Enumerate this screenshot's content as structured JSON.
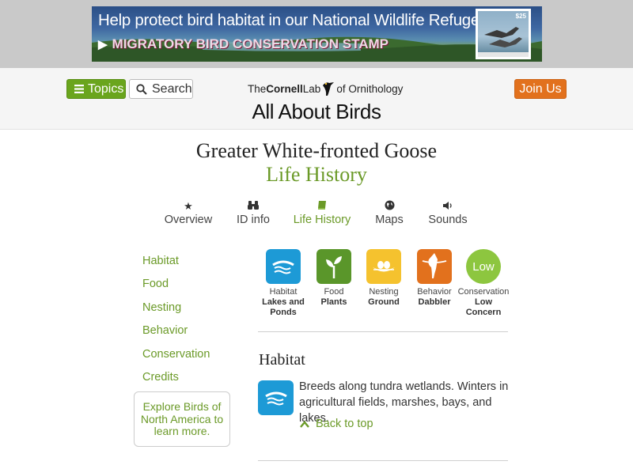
{
  "banner": {
    "headline": "Help protect bird habitat in our National Wildlife Refuges!",
    "subline": "MIGRATORY BIRD CONSERVATION STAMP",
    "play_icon": "play-icon",
    "stamp_price": "$25"
  },
  "header": {
    "topics_label": "Topics",
    "search_label": "Search",
    "join_label": "Join Us",
    "logo_prefix": "The",
    "logo_name": "Cornell",
    "logo_lab": "Lab",
    "logo_suffix": "of Ornithology",
    "site_title": "All About Birds"
  },
  "species": {
    "name": "Greater White-fronted Goose",
    "section": "Life History"
  },
  "tabs": [
    {
      "label": "Overview",
      "icon": "star-icon",
      "active": false
    },
    {
      "label": "ID info",
      "icon": "binoculars-icon",
      "active": false
    },
    {
      "label": "Life History",
      "icon": "book-icon",
      "active": true
    },
    {
      "label": "Maps",
      "icon": "globe-icon",
      "active": false
    },
    {
      "label": "Sounds",
      "icon": "speaker-icon",
      "active": false
    }
  ],
  "sidebar": {
    "links": [
      "Habitat",
      "Food",
      "Nesting",
      "Behavior",
      "Conservation",
      "Credits"
    ],
    "explore": "Explore Birds of North America to learn more."
  },
  "facts": [
    {
      "label": "Habitat",
      "value": "Lakes and Ponds",
      "icon": "water-icon",
      "color": "#1d9ad6"
    },
    {
      "label": "Food",
      "value": "Plants",
      "icon": "sprout-icon",
      "color": "#5a962a"
    },
    {
      "label": "Nesting",
      "value": "Ground",
      "icon": "nest-icon",
      "color": "#f5c22e"
    },
    {
      "label": "Behavior",
      "value": "Dabbler",
      "icon": "dabbling-duck-icon",
      "color": "#e2711d"
    },
    {
      "label": "Conservation",
      "value": "Low Concern",
      "badge": "Low",
      "color": "#8dc63f"
    }
  ],
  "habitat": {
    "heading": "Habitat",
    "text": "Breeds along tundra wetlands. Winters in agricultural fields, marshes, bays, and lakes.",
    "back_to_top": "Back to top"
  },
  "colors": {
    "accent_green": "#6b9a28",
    "topics_green": "#6aa51d",
    "join_orange": "#e2711d",
    "habitat_blue": "#1d9ad6"
  }
}
